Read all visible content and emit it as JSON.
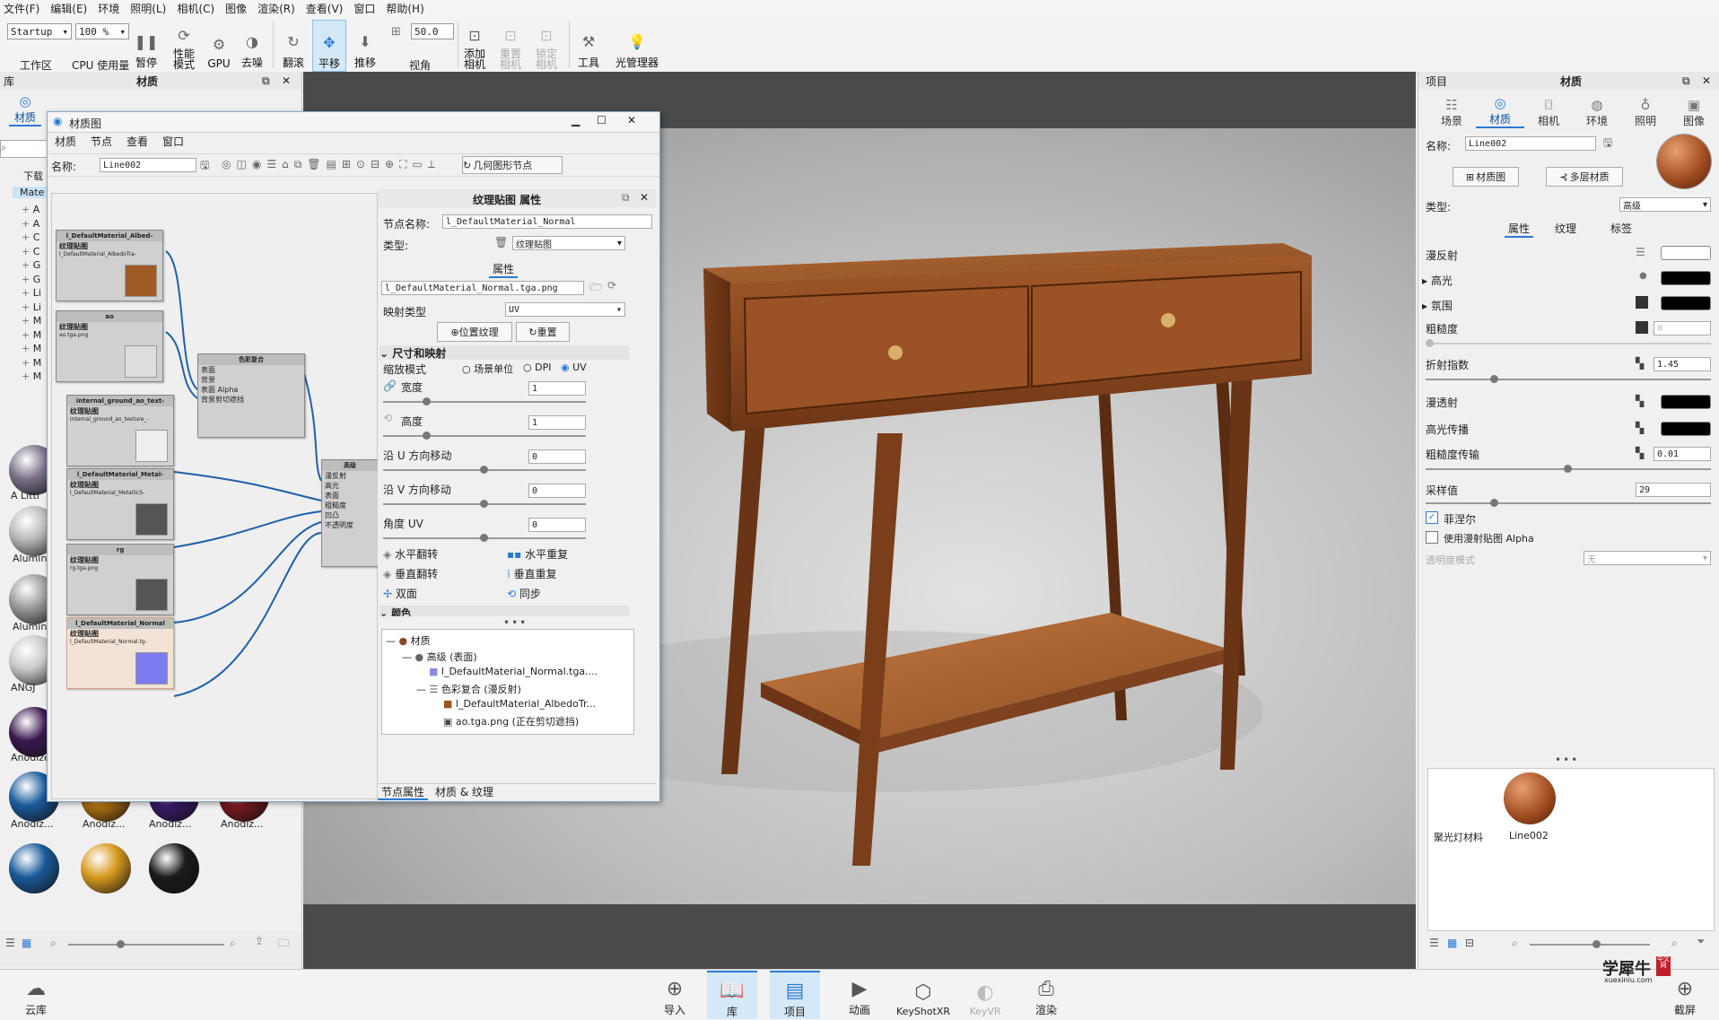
{
  "menu": [
    "文件(F)",
    "编辑(E)",
    "环境",
    "照明(L)",
    "相机(C)",
    "图像",
    "渲染(R)",
    "查看(V)",
    "窗口",
    "帮助(H)"
  ],
  "toolbar": {
    "workspace_value": "Startup",
    "workspace_label": "工作区",
    "cpu_value": "100 %",
    "cpu_label": "CPU 使用量",
    "pause_label": "暂停",
    "perf_label": "性能\n模式",
    "gpu_label": "GPU",
    "denoise_label": "去噪",
    "tumble_label": "翻滚",
    "pan_label": "平移",
    "dolly_label": "推移",
    "fov_value": "50.0",
    "fov_label": "视角",
    "add_camera_label": "添加\n相机",
    "reset_camera_label": "重置\n相机",
    "lock_camera_label": "锁定\n相机",
    "tools_label": "工具",
    "light_manager_label": "光管理器"
  },
  "library": {
    "title": "库",
    "panel_title": "材质",
    "tabs": [
      "材质"
    ],
    "tree_items": [
      "A",
      "A",
      "C",
      "C",
      "G",
      "G",
      "Li",
      "Li",
      "M",
      "M",
      "M",
      "M",
      "M"
    ],
    "root_label": "Mate",
    "prev_label": "下载",
    "swatch_labels": [
      "A Littl",
      "Alumin",
      "Alumin",
      "ANGJ",
      "Anodize...",
      "Anodiz...",
      "Anodize...",
      "Anodiz...",
      "Anodiz...",
      "Anodiz...",
      "Anodiz...",
      "Anodiz..."
    ]
  },
  "matgraph": {
    "window_title": "材质图",
    "menu": [
      "材质",
      "节点",
      "查看",
      "窗口"
    ],
    "name_label": "名称:",
    "name_value": "Line002",
    "geometry_node_button": "几何图形节点",
    "nodes": [
      {
        "title": "l_DefaultMaterial_Albed-",
        "label": "纹理贴图",
        "sub": "l_DefaultMaterial_AlbedoTra-"
      },
      {
        "title": "ao",
        "label": "纹理贴图",
        "sub": "ao.tga.png"
      },
      {
        "title": "internal_ground_ao_text-",
        "label": "纹理贴图",
        "sub": "internal_ground_ao_texture_-"
      },
      {
        "title": "l_DefaultMaterial_Metal-",
        "label": "纹理贴图",
        "sub": "l_DefaultMaterial_MetallicS-"
      },
      {
        "title": "rg",
        "label": "纹理贴图",
        "sub": "rg.tga.png"
      },
      {
        "title": "l_DefaultMaterial_Normal",
        "label": "纹理贴图",
        "sub": "l_DefaultMaterial_Normal.tg-"
      }
    ],
    "color_node": {
      "title": "色彩复合",
      "ports": [
        "表面",
        "背景",
        "表面 Alpha",
        "背景剪切遮挡"
      ]
    },
    "adv_node": {
      "title": "高级",
      "ports": [
        "漫反射",
        "高光",
        "表面",
        "粗糙度",
        "凹凸",
        "不透明度"
      ]
    }
  },
  "props": {
    "header": "纹理贴图  属性",
    "node_name_label": "节点名称:",
    "node_name_value": "l_DefaultMaterial_Normal",
    "type_label": "类型:",
    "type_value": "纹理贴图",
    "tab": "属性",
    "file_value": "l_DefaultMaterial_Normal.tga.png",
    "mapping_label": "映射类型",
    "mapping_value": "UV",
    "position_btn": "位置纹理",
    "reset_btn": "重置",
    "section_size": "尺寸和映射",
    "scale_mode_label": "缩放模式",
    "scale_opts": [
      "场景单位",
      "DPI",
      "UV"
    ],
    "width_label": "宽度",
    "width_value": "1",
    "height_label": "高度",
    "height_value": "1",
    "u_shift_label": "沿 U 方向移动",
    "u_shift_value": "0",
    "v_shift_label": "沿 V 方向移动",
    "v_shift_value": "0",
    "angle_label": "角度 UV",
    "angle_value": "0",
    "flip_h": "水平翻转",
    "repeat_h": "水平重复",
    "flip_v": "垂直翻转",
    "repeat_v": "垂直重复",
    "two_sided": "双面",
    "sync": "同步",
    "section_color": "颜色",
    "tree": [
      "材质",
      "高级 (表面)",
      "l_DefaultMaterial_Normal.tga....",
      "色彩复合 (漫反射)",
      "l_DefaultMaterial_AlbedoTr...",
      "ao.tga.png (正在剪切遮挡)"
    ],
    "bottom_tabs": [
      "节点属性",
      "材质 & 纹理"
    ]
  },
  "project": {
    "title": "项目",
    "panel_title": "材质",
    "tabs": [
      "场景",
      "材质",
      "相机",
      "环境",
      "照明",
      "图像"
    ],
    "name_label": "名称:",
    "name_value": "Line002",
    "matgraph_btn": "材质图",
    "multilayer_btn": "多层材质",
    "type_label": "类型:",
    "type_value": "高级",
    "subtabs": [
      "属性",
      "纹理",
      "标签"
    ],
    "diffuse_label": "漫反射",
    "specular_label": "高光",
    "ambient_label": "氛围",
    "roughness_label": "粗糙度",
    "roughness_value": "0",
    "ior_label": "折射指数",
    "ior_value": "1.45",
    "translucency_label": "漫透射",
    "spec_trans_label": "高光传播",
    "rough_trans_label": "粗糙度传输",
    "rough_trans_value": "0.01",
    "samples_label": "采样值",
    "samples_value": "29",
    "fresnel_label": "菲涅尔",
    "alpha_label": "使用漫射贴图 Alpha",
    "transparency_label": "透明度模式",
    "transparency_value": "无",
    "thumb_labels": [
      "聚光灯材料",
      "Line002"
    ]
  },
  "dock": {
    "cloud_label": "云库",
    "items": [
      "导入",
      "库",
      "项目",
      "动画",
      "KeyShotXR",
      "KeyVR",
      "渲染"
    ],
    "screenshot_label": "截屏"
  },
  "watermark": {
    "main": "学犀牛",
    "badge": "中文网",
    "url": "xuexiniu.com"
  },
  "colors": {
    "accent": "#2a7ad2",
    "wood": "#8a4a24",
    "viewport": "#9a9a9a",
    "panel": "#f0f0f0"
  }
}
